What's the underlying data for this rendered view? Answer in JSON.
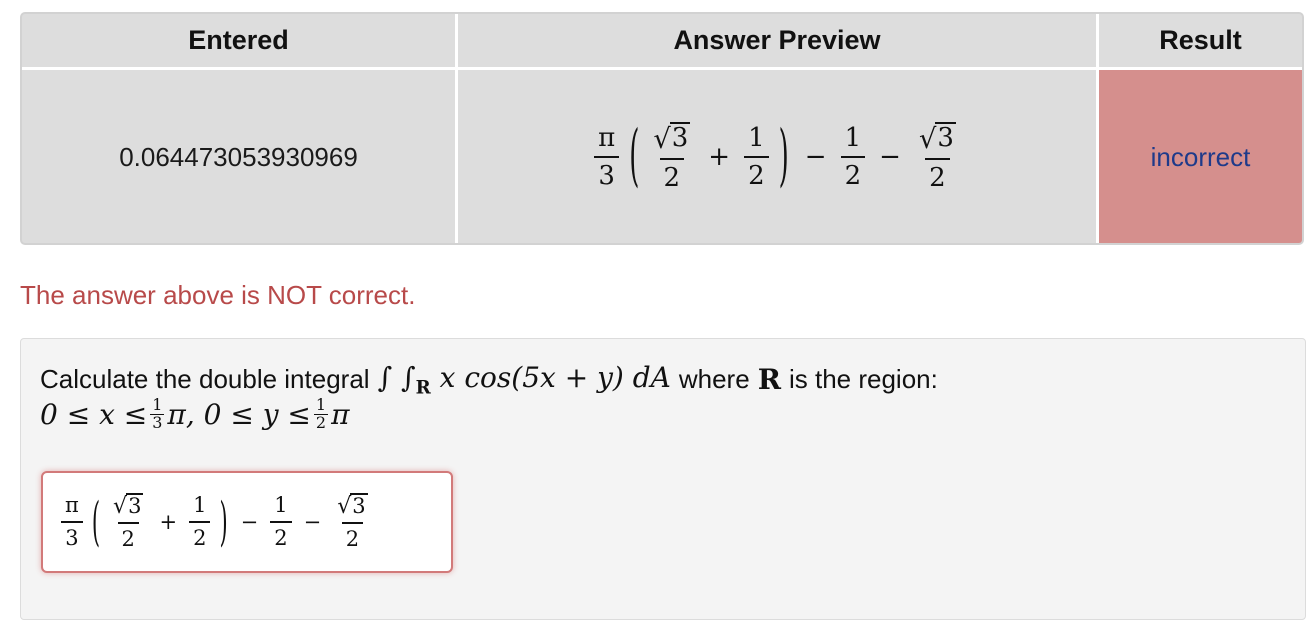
{
  "results_table": {
    "headers": [
      "Entered",
      "Answer Preview",
      "Result"
    ],
    "entered_value": "0.064473053930969",
    "preview": {
      "pi": "π",
      "three": "3",
      "two": "2",
      "one": "1",
      "plus": "+",
      "minus": "−",
      "lparen": "(",
      "rparen": ")",
      "radical": "√"
    },
    "result_text": "incorrect"
  },
  "feedback_message": "The answer above is NOT correct.",
  "problem": {
    "prefix": "Calculate the double integral",
    "integral_expression": "∫ ∫",
    "region_symbol": "R",
    "integrand": "x cos(5x + y) dA",
    "middle_text": "where",
    "region_bold": "R",
    "suffix": "is the region:",
    "constraint_part1": "0 ≤ x ≤",
    "constraint_frac1_num": "1",
    "constraint_frac1_den": "3",
    "constraint_part2": "π, 0 ≤ y ≤",
    "constraint_frac2_num": "1",
    "constraint_frac2_den": "2",
    "constraint_part3": "π"
  },
  "colors": {
    "incorrect_cell_bg": "#d58f8d",
    "incorrect_text": "#1e3a8a",
    "feedback_text": "#b84a4a",
    "answer_border": "#d27a7a"
  }
}
